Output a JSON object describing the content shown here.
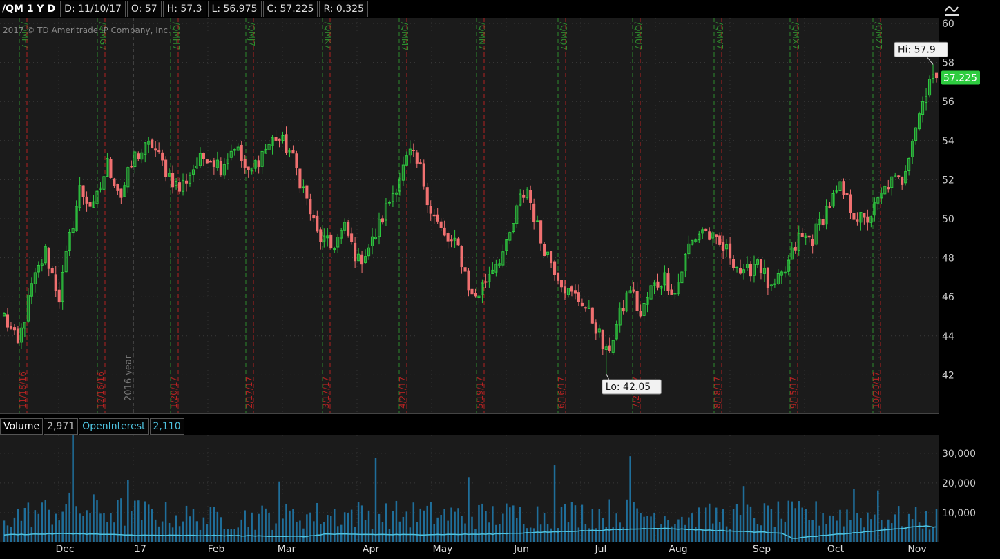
{
  "header": {
    "symbol": "/QM 1 Y D",
    "date": "D: 11/10/17",
    "open": "O: 57",
    "high": "H: 57.3",
    "low": "L: 56.975",
    "close": "C: 57.225",
    "range": "R: 0.325"
  },
  "watermark": "2017 © TD Ameritrade IP Company, Inc.",
  "year_marker": "2016 year",
  "volume_header": {
    "volume_label": "Volume",
    "volume_value": "2,971",
    "oi_label": "OpenInterest",
    "oi_value": "2,110"
  },
  "colors": {
    "up": "#2ecc40",
    "down": "#f07070",
    "volume": "#1f6e9a",
    "open_interest": "#4fc3e0",
    "current_badge": "#2ecc40",
    "roll_line": "#2e8b2e",
    "expiry_line": "#b22222"
  },
  "chart_data": [
    {
      "type": "candlestick",
      "series": [
        {
          "name": "/QM 1 Y D"
        }
      ],
      "ylim": [
        40,
        60
      ],
      "yticks": [
        42,
        44,
        46,
        48,
        50,
        52,
        54,
        56,
        58,
        60
      ],
      "ytick_labels": [
        "42",
        "44",
        "46",
        "48",
        "50",
        "52",
        "54",
        "56",
        "58",
        "60"
      ],
      "grid": true,
      "current_price": 57.225,
      "current_price_label": "57.225",
      "high_label": "Hi: 57.9",
      "low_label": "Lo: 42.05",
      "x_months": [
        "Dec",
        "17",
        "Feb",
        "Mar",
        "Apr",
        "May",
        "Jun",
        "Jul",
        "Aug",
        "Sep",
        "Oct",
        "Nov"
      ],
      "roll_markers": [
        "/QMF7",
        "/QMG7",
        "/QMH7",
        "/QMJ7",
        "/QMK7",
        "/QMM7",
        "/QMN7",
        "/QMQ7",
        "/QMU7",
        "/QMV7",
        "/QMX7",
        "/QMZ7"
      ],
      "expiry_dates": [
        "11/18/16",
        "12/16/16",
        "1/20/17",
        "2/17/17",
        "3/17/17",
        "4/21/17",
        "5/19/17",
        "6/16/17",
        "7/21/17",
        "8/18/17",
        "9/15/17",
        "10/20/17"
      ],
      "anchors": [
        [
          0,
          45.0
        ],
        [
          4,
          43.5
        ],
        [
          8,
          46.5
        ],
        [
          12,
          48.3
        ],
        [
          16,
          46.0
        ],
        [
          19,
          49.0
        ],
        [
          22,
          51.5
        ],
        [
          26,
          50.5
        ],
        [
          30,
          52.8
        ],
        [
          34,
          51.2
        ],
        [
          38,
          53.2
        ],
        [
          43,
          53.8
        ],
        [
          47,
          52.5
        ],
        [
          51,
          51.5
        ],
        [
          55,
          52.6
        ],
        [
          59,
          53.3
        ],
        [
          63,
          52.7
        ],
        [
          67,
          53.8
        ],
        [
          71,
          52.2
        ],
        [
          75,
          53.4
        ],
        [
          79,
          54.2
        ],
        [
          83,
          53.5
        ],
        [
          87,
          51.5
        ],
        [
          91,
          49.2
        ],
        [
          95,
          48.5
        ],
        [
          99,
          49.5
        ],
        [
          103,
          47.8
        ],
        [
          107,
          48.8
        ],
        [
          111,
          50.5
        ],
        [
          115,
          52.2
        ],
        [
          118,
          53.3
        ],
        [
          121,
          52.5
        ],
        [
          124,
          50.5
        ],
        [
          128,
          49.0
        ],
        [
          132,
          48.5
        ],
        [
          136,
          46.0
        ],
        [
          138,
          46.2
        ],
        [
          142,
          47.6
        ],
        [
          146,
          48.5
        ],
        [
          150,
          51.0
        ],
        [
          152,
          51.5
        ],
        [
          156,
          48.9
        ],
        [
          160,
          47.5
        ],
        [
          164,
          46.2
        ],
        [
          168,
          45.8
        ],
        [
          172,
          44.5
        ],
        [
          175,
          43.0
        ],
        [
          178,
          44.5
        ],
        [
          182,
          46.5
        ],
        [
          185,
          45.0
        ],
        [
          188,
          46.4
        ],
        [
          192,
          47.0
        ],
        [
          195,
          46.2
        ],
        [
          199,
          48.6
        ],
        [
          203,
          49.5
        ],
        [
          207,
          48.7
        ],
        [
          211,
          48.2
        ],
        [
          215,
          47.0
        ],
        [
          219,
          48.0
        ],
        [
          223,
          46.2
        ],
        [
          227,
          47.3
        ],
        [
          231,
          49.0
        ],
        [
          235,
          49.0
        ],
        [
          239,
          50.5
        ],
        [
          243,
          51.5
        ],
        [
          247,
          50.3
        ],
        [
          250,
          49.8
        ],
        [
          253,
          50.5
        ],
        [
          257,
          51.8
        ],
        [
          261,
          52.0
        ],
        [
          264,
          54.2
        ],
        [
          267,
          56.0
        ],
        [
          269,
          57.3
        ],
        [
          271,
          57.225
        ]
      ]
    },
    {
      "type": "bar",
      "series": [
        {
          "name": "Volume"
        },
        {
          "name": "OpenInterest"
        }
      ],
      "ylim": [
        0,
        36000
      ],
      "yticks": [
        10000,
        20000,
        30000
      ],
      "ytick_labels": [
        "10,000",
        "20,000",
        "30,000"
      ],
      "grid": true,
      "spikes": [
        [
          20,
          36500
        ],
        [
          108,
          28500
        ],
        [
          160,
          26000
        ],
        [
          182,
          29000
        ],
        [
          36,
          21000
        ],
        [
          80,
          20500
        ],
        [
          135,
          22000
        ],
        [
          215,
          19000
        ],
        [
          247,
          18000
        ],
        [
          254,
          17500
        ]
      ],
      "volume_level_anchors": [
        [
          0,
          9000
        ],
        [
          20,
          12000
        ],
        [
          60,
          8500
        ],
        [
          100,
          10000
        ],
        [
          140,
          9500
        ],
        [
          180,
          10500
        ],
        [
          200,
          9000
        ],
        [
          240,
          10000
        ],
        [
          271,
          8000
        ]
      ],
      "oi_anchors": [
        [
          0,
          2600
        ],
        [
          19,
          3000
        ],
        [
          40,
          2400
        ],
        [
          66,
          2300
        ],
        [
          88,
          2000
        ],
        [
          93,
          2800
        ],
        [
          118,
          2600
        ],
        [
          141,
          2800
        ],
        [
          190,
          4800
        ],
        [
          226,
          3200
        ],
        [
          229,
          1400
        ],
        [
          250,
          3500
        ],
        [
          268,
          5600
        ],
        [
          272,
          5000
        ],
        [
          278,
          2300
        ],
        [
          300,
          2000
        ]
      ]
    }
  ]
}
